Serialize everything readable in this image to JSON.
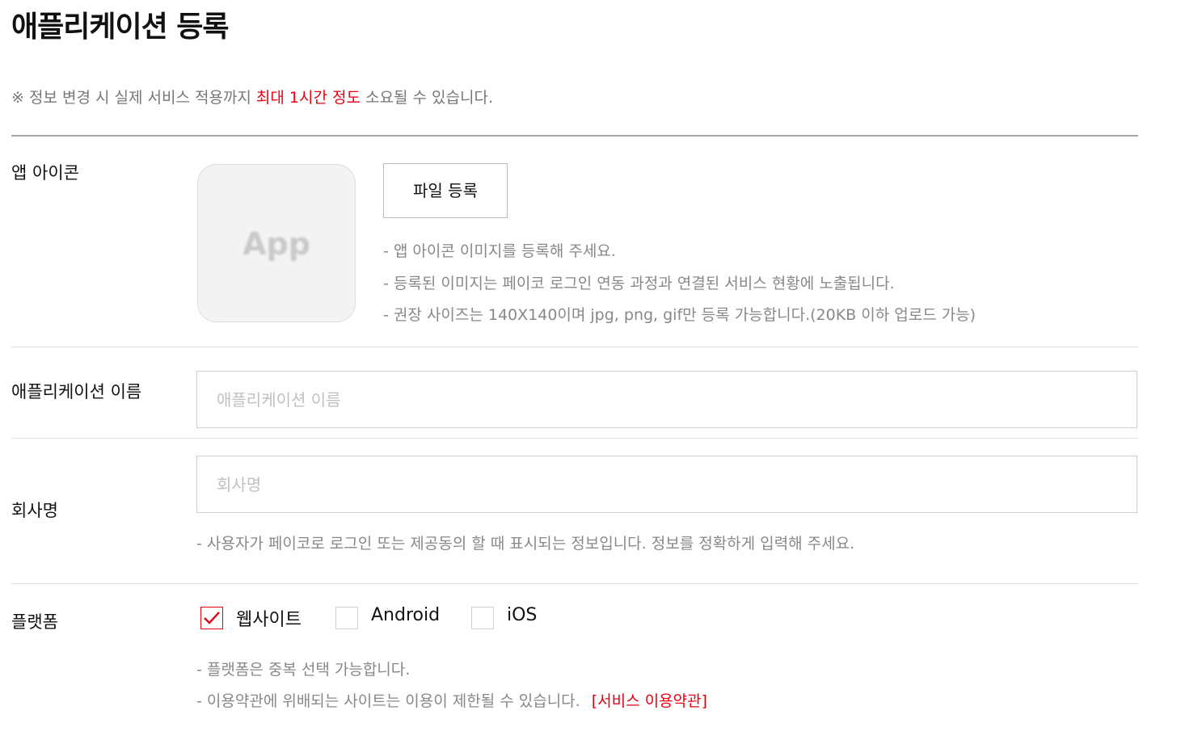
{
  "page": {
    "title": "애플리케이션 등록",
    "notice_prefix": "※ 정보 변경 시 실제 서비스 적용까지 ",
    "notice_highlight": "최대 1시간 정도",
    "notice_suffix": " 소요될 수 있습니다."
  },
  "app_icon": {
    "label": "앱 아이콘",
    "placeholder_text": "App",
    "upload_button": "파일 등록",
    "help": [
      "- 앱 아이콘 이미지를 등록해 주세요.",
      "- 등록된 이미지는 페이코 로그인 연동 과정과 연결된 서비스 현황에 노출됩니다.",
      "- 권장 사이즈는 140X140이며 jpg, png, gif만 등록 가능합니다.(20KB 이하 업로드 가능)"
    ]
  },
  "app_name": {
    "label": "애플리케이션 이름",
    "placeholder": "애플리케이션 이름",
    "value": ""
  },
  "company": {
    "label": "회사명",
    "placeholder": "회사명",
    "value": "",
    "help": "- 사용자가 페이코로 로그인 또는 제공동의 할 때 표시되는 정보입니다. 정보를 정확하게 입력해 주세요."
  },
  "platform": {
    "label": "플랫폼",
    "options": [
      {
        "label": "웹사이트",
        "checked": true
      },
      {
        "label": "Android",
        "checked": false
      },
      {
        "label": "iOS",
        "checked": false
      }
    ],
    "help": [
      "- 플랫폼은 중복 선택 가능합니다.",
      "- 이용약관에 위배되는 사이트는 이용이 제한될 수 있습니다."
    ],
    "terms_link": "[서비스 이용약관]"
  },
  "colors": {
    "accent_red": "#e60012",
    "help_gray": "#888888",
    "border_gray": "#cfcfcf"
  }
}
